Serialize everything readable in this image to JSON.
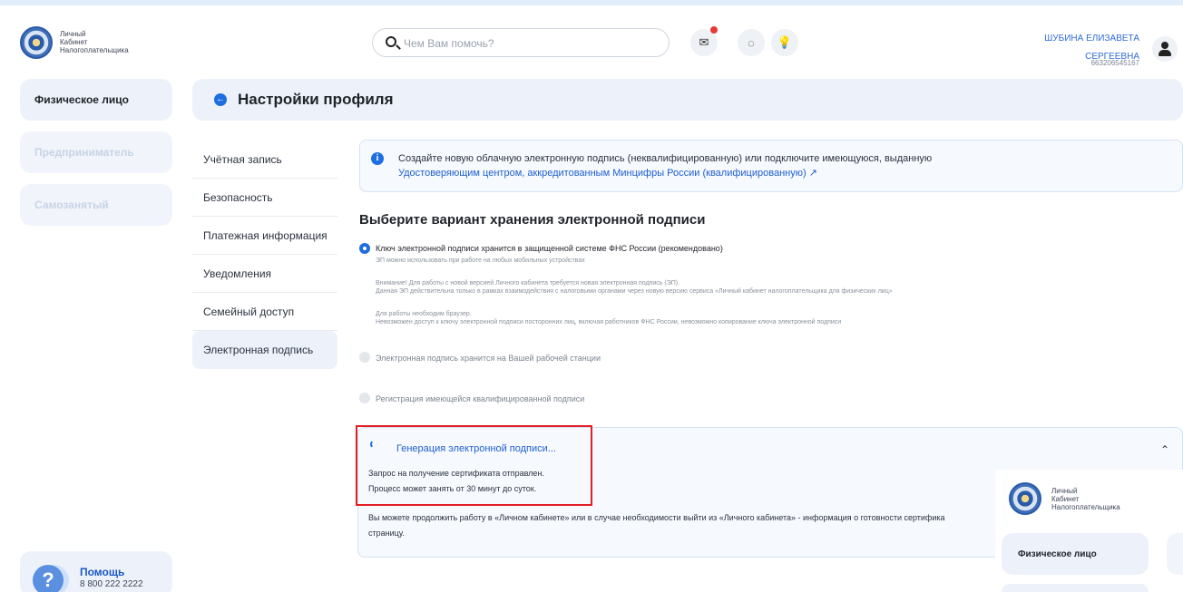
{
  "header": {
    "logo_lines": [
      "Личный",
      "Кабинет",
      "Налогоплательщика"
    ],
    "search_placeholder": "Чем Вам помочь?",
    "icons": [
      "mail-icon",
      "eye-slash-icon",
      "lightbulb-icon"
    ],
    "user_name_line1": "ШУБИНА ЕЛИЗАВЕТА",
    "user_name_line2": "СЕРГЕЕВНА",
    "user_inn": "663206545167"
  },
  "sidebar": {
    "items": [
      "Физическое лицо",
      "Предприниматель",
      "Самозанятый"
    ],
    "help_title": "Помощь",
    "help_phone": "8 800 222 2222"
  },
  "page": {
    "title": "Настройки профиля",
    "menu": [
      "Учётная запись",
      "Безопасность",
      "Платежная информация",
      "Уведомления",
      "Семейный доступ",
      "Электронная подпись"
    ]
  },
  "info": {
    "text": "Создайте новую облачную электронную подпись (неквалифицированную) или подключите имеющуюся, выданную",
    "link": "Удостоверяющим центром, аккредитованным Минцифры России (квалифицированную) ↗"
  },
  "storage": {
    "title": "Выберите вариант хранения электронной подписи",
    "option1": "Ключ электронной подписи хранится в защищенной системе ФНС России (рекомендовано)",
    "note1": "ЭП можно использовать при работе на любых мобильных устройствах",
    "note2a": "Внимание! Для работы с новой версией Личного кабинета требуется новая электронная подпись (ЭП).",
    "note2b": "Данная ЭП действительна только в рамках взаимодействия с налоговыми органами через новую версию сервиса «Личный кабинет налогоплательщика для физических лиц»",
    "note3a": "Для работы необходим браузер.",
    "note3b": "Невозможен доступ к ключу электронной подписи посторонних лиц, включая работников ФНС России, невозможно копирование ключа электронной подписи",
    "option2": "Электронная подпись хранится на Вашей рабочей станции",
    "option3": "Регистрация имеющейся квалифицированной подписи"
  },
  "generation": {
    "title": "Генерация электронной подписи...",
    "line1": "Запрос на получение сертификата отправлен.",
    "line2": "Процесс может занять от 30 минут до суток.",
    "continue_line1": "Вы можете продолжить работу в «Личном кабинете» или в случае необходимости выйти из «Личного кабинета» - информация о готовности сертифика",
    "continue_line2": "страницу."
  },
  "overlay": {
    "logo_lines": [
      "Личный",
      "Кабинет",
      "Налогоплательщика"
    ],
    "card_label": "Физическое лицо"
  }
}
